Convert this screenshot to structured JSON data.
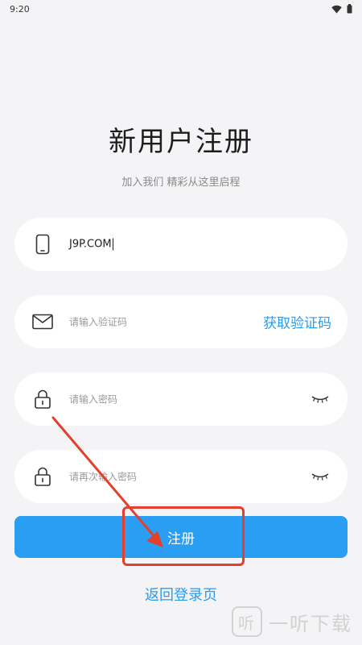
{
  "status_bar": {
    "time": "9:20",
    "icons": [
      "wifi-icon",
      "battery-icon"
    ]
  },
  "header": {
    "title": "新用户注册",
    "subtitle": "加入我们 精彩从这里启程"
  },
  "form": {
    "phone": {
      "value": "J9P.COM",
      "icon": "phone-icon"
    },
    "code": {
      "placeholder": "请输入验证码",
      "action_label": "获取验证码",
      "icon": "mail-icon"
    },
    "password": {
      "placeholder": "请输入密码",
      "icon": "lock-icon",
      "toggle_icon": "eye-closed-icon"
    },
    "confirm_password": {
      "placeholder": "请再次输入密码",
      "icon": "lock-icon",
      "toggle_icon": "eye-closed-icon"
    }
  },
  "buttons": {
    "register_label": "注册",
    "back_label": "返回登录页"
  },
  "watermark": {
    "logo": "听",
    "text": "一听下载"
  },
  "colors": {
    "accent": "#2a9ef2",
    "annotation": "#e2402c",
    "background": "#f4f4f6"
  }
}
